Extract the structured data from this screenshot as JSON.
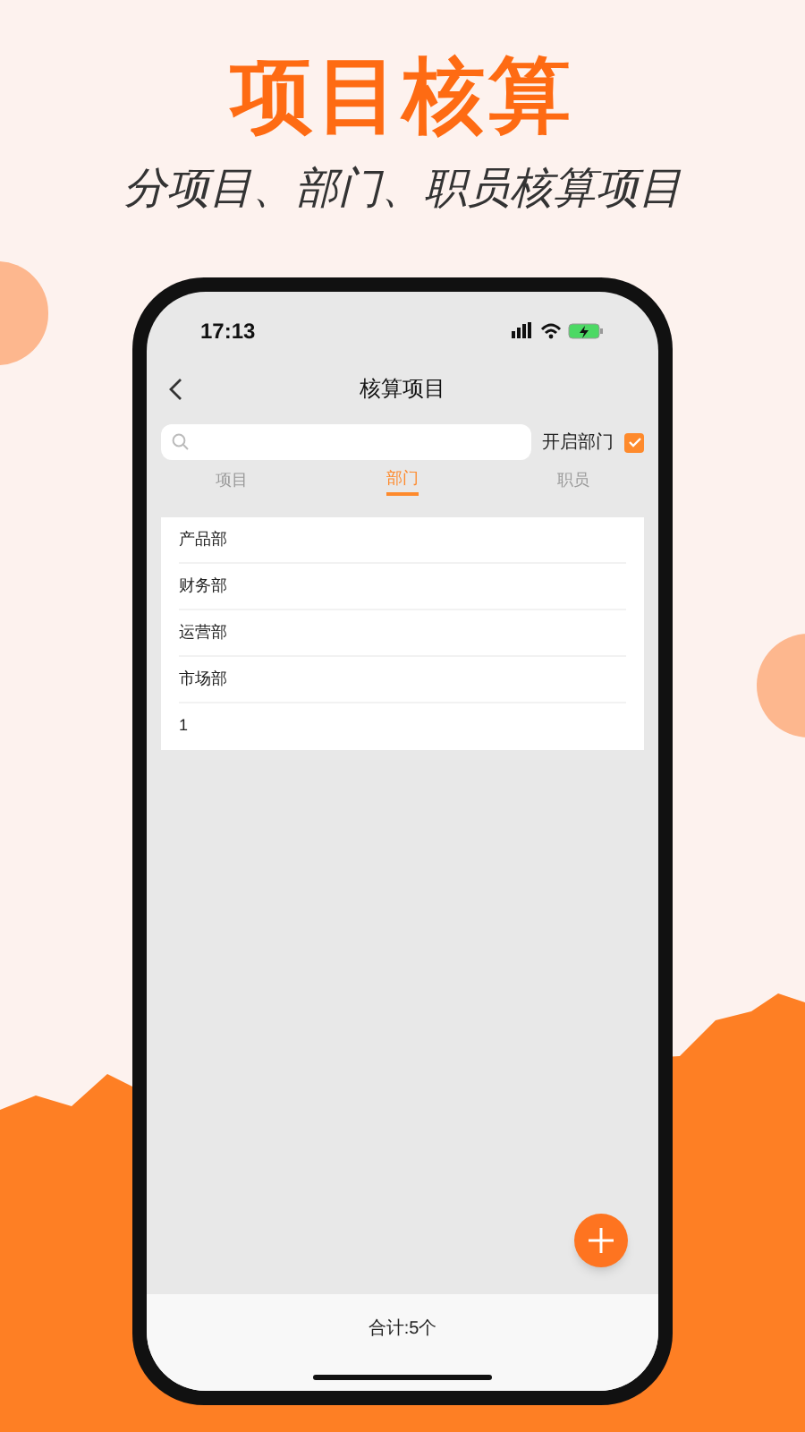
{
  "headline": "项目核算",
  "subtitle": "分项目、部门、职员核算项目",
  "status_bar": {
    "time": "17:13"
  },
  "nav": {
    "title": "核算项目"
  },
  "toggle": {
    "label": "开启部门",
    "checked": true
  },
  "tabs": [
    {
      "label": "项目",
      "selected": false
    },
    {
      "label": "部门",
      "selected": true
    },
    {
      "label": "职员",
      "selected": false
    }
  ],
  "items": [
    "产品部",
    "财务部",
    "运营部",
    "市场部",
    "1"
  ],
  "footer": {
    "total": "合计:5个"
  }
}
